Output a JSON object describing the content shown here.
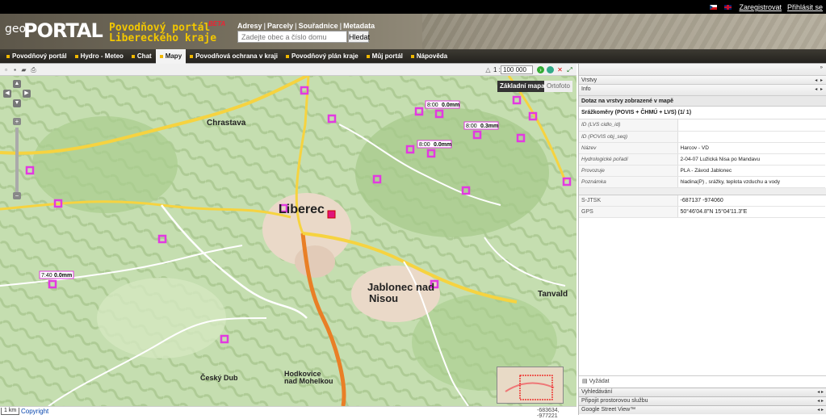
{
  "topbar": {
    "register": "Zaregistrovat",
    "login": "Přihlásit se"
  },
  "header": {
    "logo_geo": "geo",
    "logo_portal": "PORTAL",
    "subtitle_line1": "Povodňový portál",
    "subtitle_line2": "Libereckého kraje",
    "beta": "BETA",
    "search_tabs": [
      "Adresy",
      "Parcely",
      "Souřadnice",
      "Metadata"
    ],
    "search_placeholder": "Zadejte obec a číslo domu",
    "search_button": "Hledat"
  },
  "nav": {
    "items": [
      {
        "label": "Povodňový portál"
      },
      {
        "label": "Hydro - Meteo"
      },
      {
        "label": "Chat"
      },
      {
        "label": "Mapy",
        "active": true
      },
      {
        "label": "Povodňová ochrana v kraji"
      },
      {
        "label": "Povodňový plán kraje"
      },
      {
        "label": "Můj portál"
      },
      {
        "label": "Nápověda"
      }
    ]
  },
  "map_toolbar": {
    "scale_prefix": "1 :",
    "scale_value": "100 000"
  },
  "map": {
    "basemap_button": "Základní mapa",
    "ortho_button": "Ortofoto",
    "places": [
      {
        "t": "Liberec",
        "big": true
      },
      {
        "t": "Jablonec nad"
      },
      {
        "t": "Nisou"
      },
      {
        "t": "Chrastava"
      },
      {
        "t": "Tanvald"
      },
      {
        "t": "Hodkovice"
      },
      {
        "t": "nad Mohelkou"
      },
      {
        "t": "Český Dub"
      }
    ],
    "station_labels": [
      {
        "time": "8:00",
        "val": "0.0mm"
      },
      {
        "time": "8:00",
        "val": "0.3mm"
      },
      {
        "time": "8:00",
        "val": "0.0mm"
      },
      {
        "time": "7:40",
        "val": "0.0mm"
      }
    ]
  },
  "map_footer": {
    "scale": "1 km",
    "copyright": "Copyright",
    "coords": "-683634, -977221"
  },
  "panel": {
    "vrstvy": "Vrstvy",
    "info": "Info",
    "query_title": "Dotaz na vrstvy zobrazené v mapě",
    "result_title": "Srážkoměry (POVIS + ČHMÚ + LVS) (1/ 1)",
    "rows": [
      {
        "k": "ID (LVS cidlo_id)",
        "v": ""
      },
      {
        "k": "ID (POVIS obj_seq)",
        "v": ""
      },
      {
        "k": "Název",
        "v": "Harcov - VD"
      },
      {
        "k": "Hydrologické pořadí",
        "v": "2-04-07 Lužická Nisa po Mandavu"
      },
      {
        "k": "Provozuje",
        "v": "PLA - Závod Jablonec"
      },
      {
        "k": "Poznámka",
        "v": "hladina(P) , srážky, teplota vzduchu a vody"
      }
    ],
    "coords": [
      {
        "k": "S-JTSK",
        "v": "-687137 -974060"
      },
      {
        "k": "GPS",
        "v": "50°46'04.8\"N 15°04'11.3\"E"
      }
    ],
    "vyzadat": "Vyžádat",
    "footers": [
      "Vyhledávání",
      "Připojit prostorovou službu",
      "Google Street View™"
    ]
  }
}
